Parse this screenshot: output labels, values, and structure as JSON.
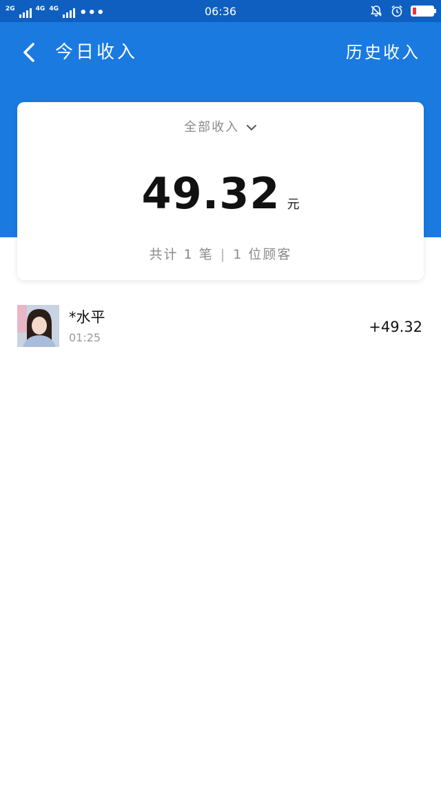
{
  "status_bar": {
    "net1": "2G",
    "net2": "4G",
    "net3": "4G",
    "dots": "•••",
    "time": "06:36"
  },
  "nav": {
    "back_icon": "chevron-left-icon",
    "title": "今日收入",
    "history_label": "历史收入"
  },
  "summary_card": {
    "filter_label": "全部收入",
    "filter_icon": "chevron-down-icon",
    "amount": "49.32",
    "unit": "元",
    "summary_count": "共计 1 笔",
    "summary_separator": "|",
    "summary_customers": "1 位顾客"
  },
  "transactions": [
    {
      "name": "*水平",
      "time": "01:25",
      "amount": "+49.32"
    }
  ],
  "colors": {
    "header_blue": "#1a7ae0",
    "status_bar_blue": "#0f5fc0",
    "battery_low": "#e53935"
  }
}
